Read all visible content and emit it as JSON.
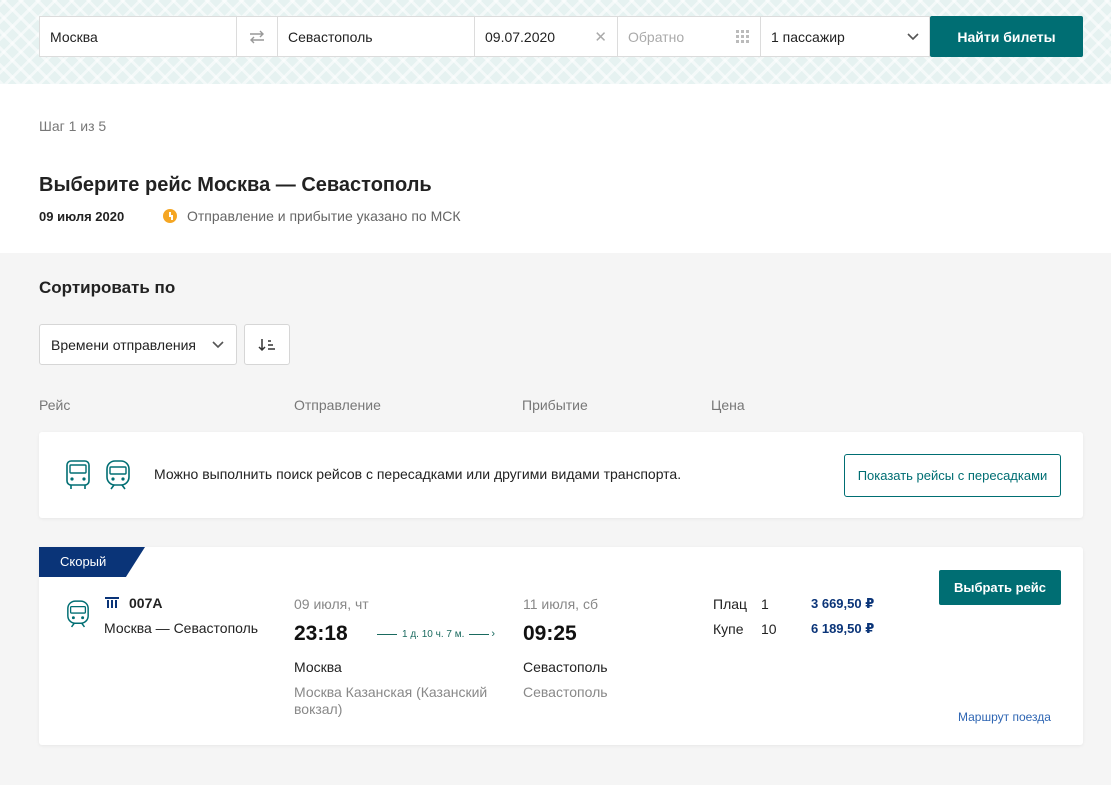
{
  "search": {
    "from": "Москва",
    "to": "Севастополь",
    "date": "09.07.2020",
    "return_placeholder": "Обратно",
    "passengers": "1 пассажир",
    "find_button": "Найти билеты"
  },
  "header": {
    "step": "Шаг 1 из 5",
    "title": "Выберите рейс Москва — Севастополь",
    "date": "09 июля 2020",
    "tz_note": "Отправление и прибытие указано по МСК"
  },
  "sort": {
    "title": "Сортировать по",
    "selected": "Времени отправления"
  },
  "columns": {
    "route": "Рейс",
    "departure": "Отправление",
    "arrival": "Прибытие",
    "price": "Цена"
  },
  "info": {
    "text": "Можно выполнить поиск рейсов с пересадками или другими видами транспорта.",
    "button": "Показать рейсы с пересадками"
  },
  "train": {
    "badge": "Скорый",
    "number": "007А",
    "route": "Москва — Севастополь",
    "departure": {
      "date": "09 июля, чт",
      "time": "23:18",
      "city": "Москва",
      "station": "Москва Казанская (Казанский вокзал)"
    },
    "duration": "1 д. 10 ч. 7 м.",
    "arrival": {
      "date": "11 июля, сб",
      "time": "09:25",
      "city": "Севастополь",
      "station": "Севастополь"
    },
    "fares": [
      {
        "class": "Плац",
        "seats": "1",
        "price": "3 669,50 ₽"
      },
      {
        "class": "Купе",
        "seats": "10",
        "price": "6 189,50 ₽"
      }
    ],
    "choose_button": "Выбрать рейс",
    "route_link": "Маршрут поезда"
  },
  "colors": {
    "accent": "#006e73",
    "badge": "#0a3478",
    "link": "#2f66b3",
    "clock": "#f5a623"
  }
}
